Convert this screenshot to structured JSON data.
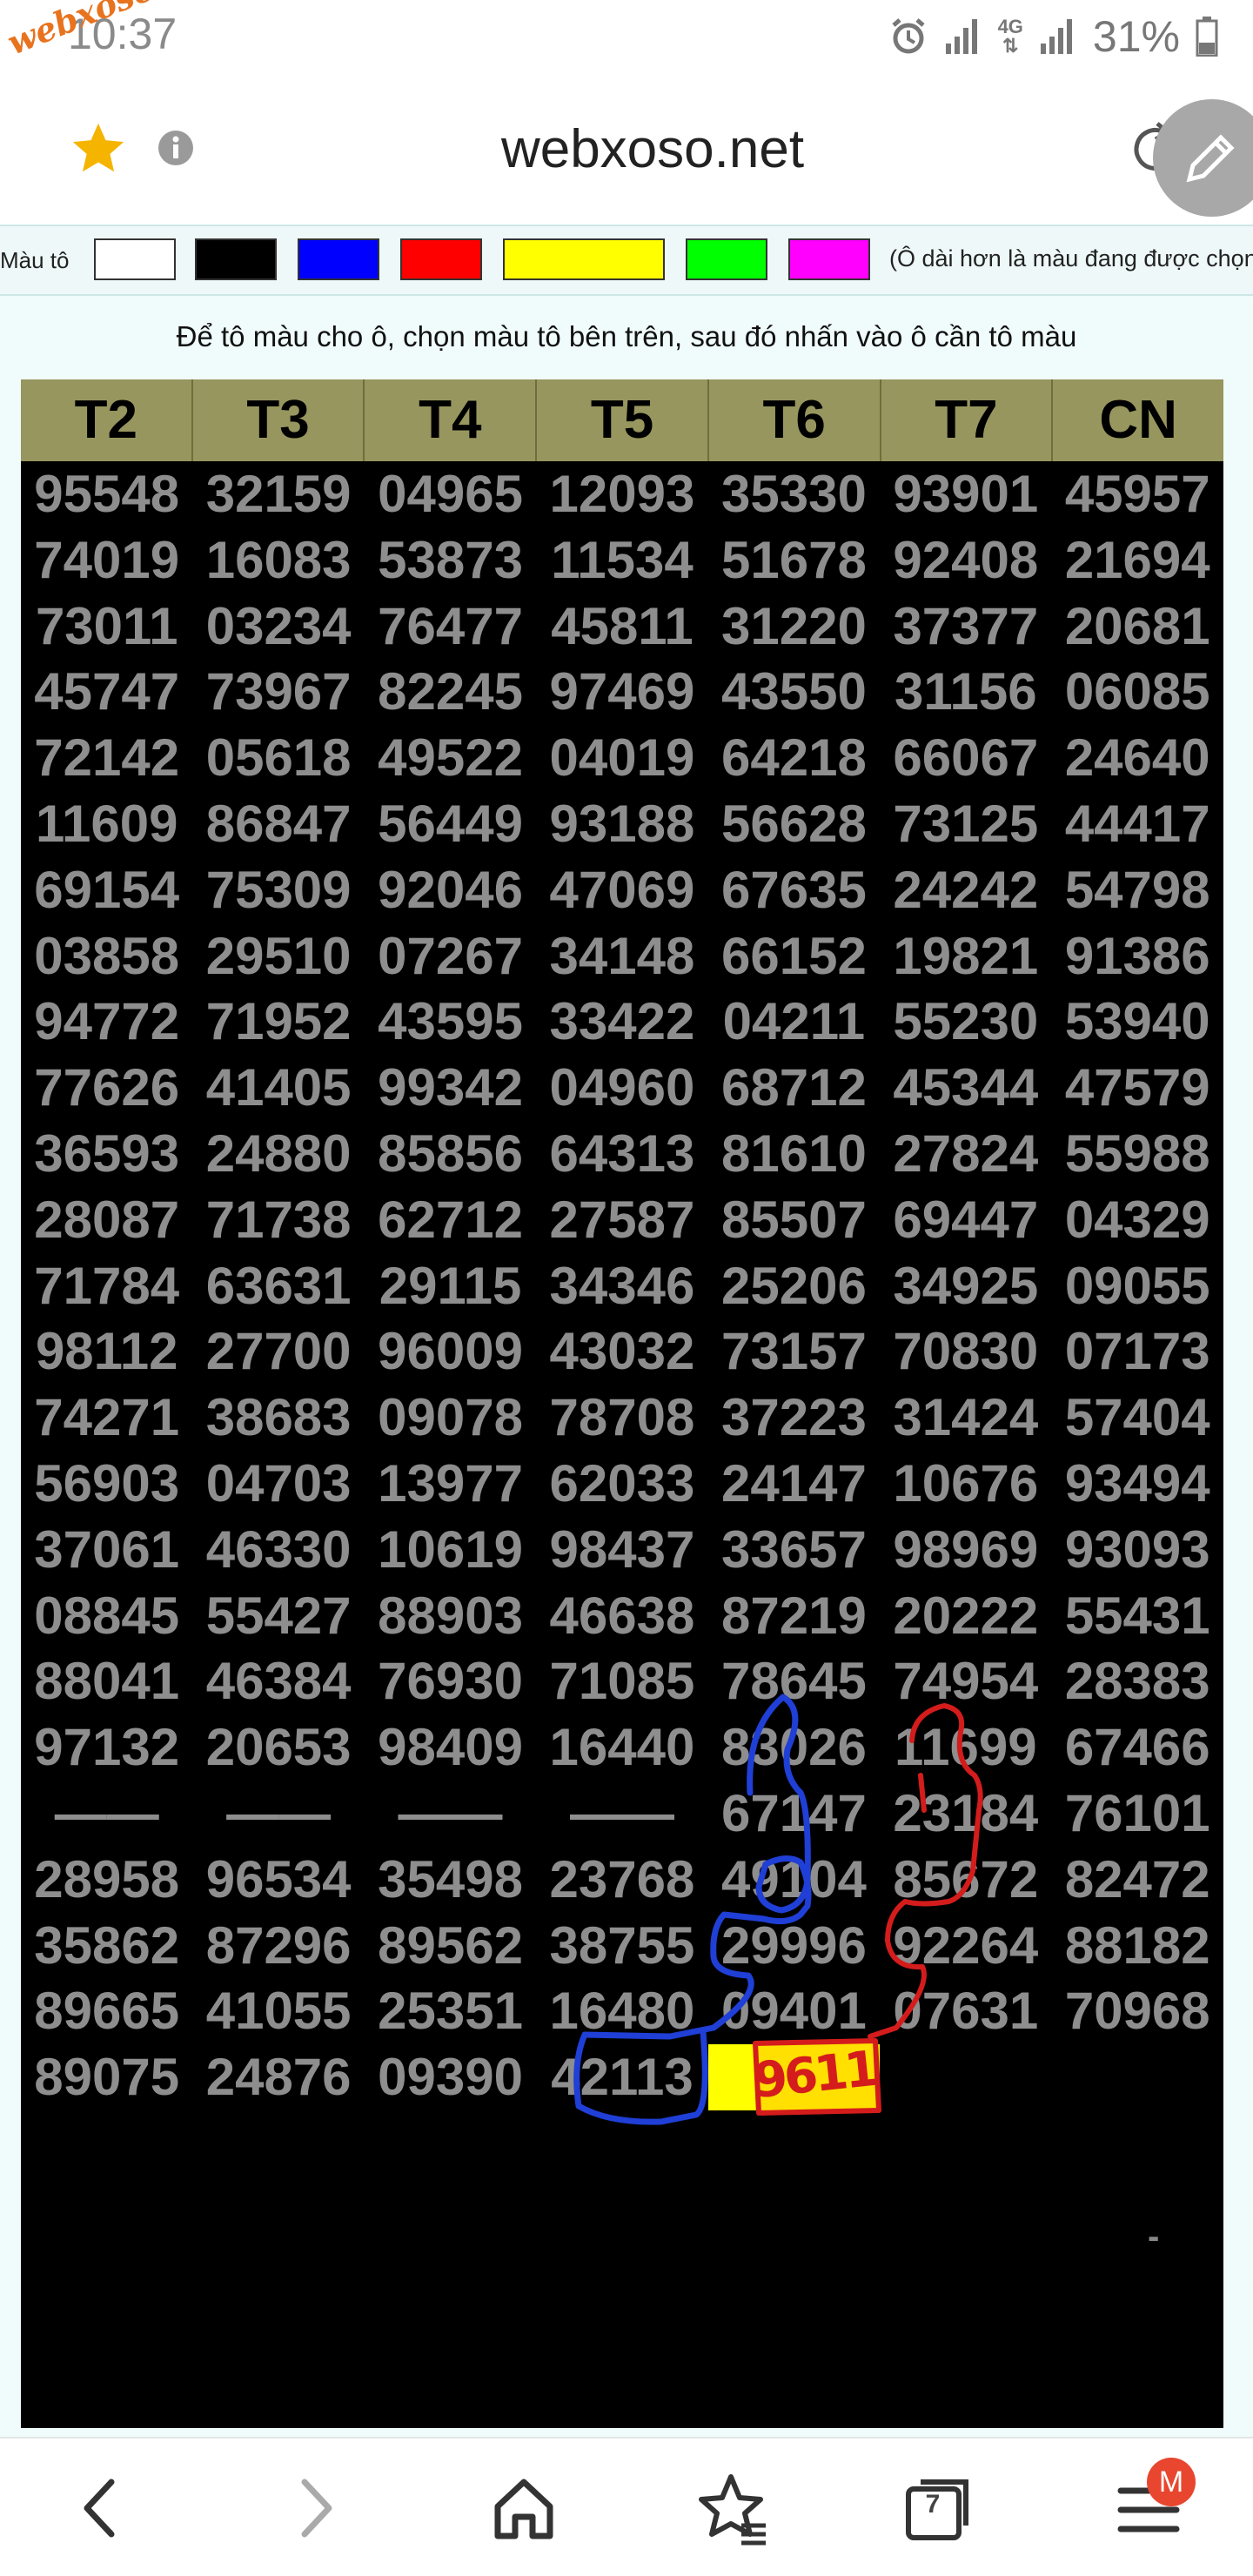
{
  "status_bar": {
    "time": "10:37",
    "watermark": "webxoso.net",
    "network": "4G",
    "battery": "31%"
  },
  "url_bar": {
    "url": "webxoso.net",
    "icons": [
      "star-icon",
      "info-icon",
      "reload-icon",
      "edit-pen-icon"
    ]
  },
  "palette": {
    "label": "Màu tô",
    "colors": [
      "#ffffff",
      "#000000",
      "#0000ff",
      "#ff0000",
      "#ffff00",
      "#00ff00",
      "#ff00ff"
    ],
    "hint": "(Ô dài hơn là màu đang được chọn)"
  },
  "instruction": "Để tô màu cho ô, chọn màu tô bên trên, sau đó nhấn vào ô cần tô màu",
  "table": {
    "headers": [
      "T2",
      "T3",
      "T4",
      "T5",
      "T6",
      "T7",
      "CN"
    ],
    "rows": [
      [
        "95548",
        "32159",
        "04965",
        "12093",
        "35330",
        "93901",
        "45957"
      ],
      [
        "74019",
        "16083",
        "53873",
        "11534",
        "51678",
        "92408",
        "21694"
      ],
      [
        "73011",
        "03234",
        "76477",
        "45811",
        "31220",
        "37377",
        "20681"
      ],
      [
        "45747",
        "73967",
        "82245",
        "97469",
        "43550",
        "31156",
        "06085"
      ],
      [
        "72142",
        "05618",
        "49522",
        "04019",
        "64218",
        "66067",
        "24640"
      ],
      [
        "11609",
        "86847",
        "56449",
        "93188",
        "56628",
        "73125",
        "44417"
      ],
      [
        "69154",
        "75309",
        "92046",
        "47069",
        "67635",
        "24242",
        "54798"
      ],
      [
        "03858",
        "29510",
        "07267",
        "34148",
        "66152",
        "19821",
        "91386"
      ],
      [
        "94772",
        "71952",
        "43595",
        "33422",
        "04211",
        "55230",
        "53940"
      ],
      [
        "77626",
        "41405",
        "99342",
        "04960",
        "68712",
        "45344",
        "47579"
      ],
      [
        "36593",
        "24880",
        "85856",
        "64313",
        "81610",
        "27824",
        "55988"
      ],
      [
        "28087",
        "71738",
        "62712",
        "27587",
        "85507",
        "69447",
        "04329"
      ],
      [
        "71784",
        "63631",
        "29115",
        "34346",
        "25206",
        "34925",
        "09055"
      ],
      [
        "98112",
        "27700",
        "96009",
        "43032",
        "73157",
        "70830",
        "07173"
      ],
      [
        "74271",
        "38683",
        "09078",
        "78708",
        "37223",
        "31424",
        "57404"
      ],
      [
        "56903",
        "04703",
        "13977",
        "62033",
        "24147",
        "10676",
        "93494"
      ],
      [
        "37061",
        "46330",
        "10619",
        "98437",
        "33657",
        "98969",
        "93093"
      ],
      [
        "08845",
        "55427",
        "88903",
        "46638",
        "87219",
        "20222",
        "55431"
      ],
      [
        "88041",
        "46384",
        "76930",
        "71085",
        "78645",
        "74954",
        "28383"
      ],
      [
        "97132",
        "20653",
        "98409",
        "16440",
        "83026",
        "11699",
        "67466"
      ],
      [
        "——",
        "——",
        "——",
        "——",
        "67147",
        "23184",
        "76101"
      ],
      [
        "28958",
        "96534",
        "35498",
        "23768",
        "49104",
        "85672",
        "82472"
      ],
      [
        "35862",
        "87296",
        "89562",
        "38755",
        "29996",
        "92264",
        "88182"
      ],
      [
        "89665",
        "41055",
        "25351",
        "16480",
        "09401",
        "07631",
        "70968"
      ],
      [
        "89075",
        "24876",
        "09390",
        "42113",
        "",
        "",
        ""
      ]
    ],
    "highlight": {
      "row": 24,
      "col": 4,
      "color": "#ffff00"
    },
    "trailing_mark": "-"
  },
  "annotation": {
    "handwritten_text": "9611",
    "blue": "#1f3fd6",
    "red": "#d41c1c"
  },
  "bottom_nav": {
    "items": [
      "back-icon",
      "forward-icon",
      "home-icon",
      "bookmarks-icon",
      "tabs-icon",
      "menu-icon"
    ],
    "tab_count": "7",
    "menu_badge": "M"
  }
}
